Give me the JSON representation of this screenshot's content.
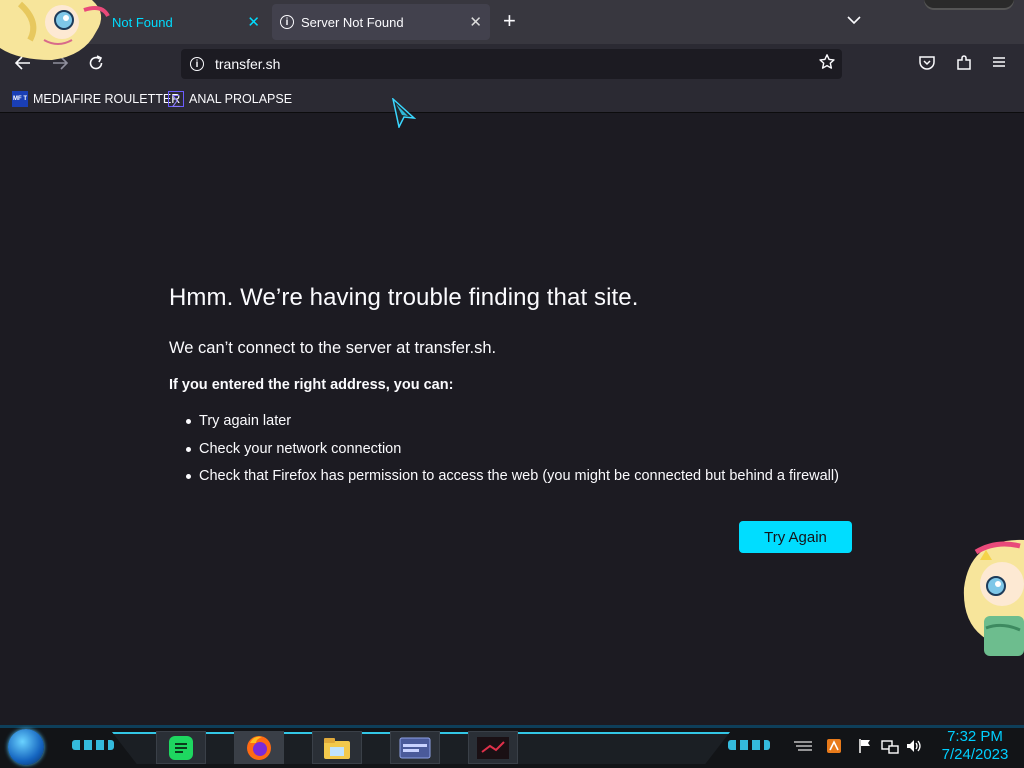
{
  "tabs": [
    {
      "label": "Not Found",
      "close": "✕"
    },
    {
      "label": "Server Not Found",
      "close": "✕"
    }
  ],
  "toolbar": {
    "url": "transfer.sh"
  },
  "bookmarks": [
    {
      "label": "MEDIAFIRE ROULETTER",
      "icon_text": "MF T"
    },
    {
      "label": "ANAL PROLAPSE"
    }
  ],
  "error": {
    "title": "Hmm. We’re having trouble finding that site.",
    "description": "We can’t connect to the server at transfer.sh.",
    "hint": "If you entered the right address, you can:",
    "suggestions": [
      "Try again later",
      "Check your network connection",
      "Check that Firefox has permission to access the web (you might be connected but behind a firewall)"
    ],
    "button_label": "Try Again"
  },
  "taskbar": {
    "time": "7:32 PM",
    "date": "7/24/2023"
  },
  "colors": {
    "accent": "#00ddff",
    "page_bg": "#1c1b22",
    "toolbar_bg": "#2b2a33",
    "tabstrip_bg": "#38373f"
  }
}
